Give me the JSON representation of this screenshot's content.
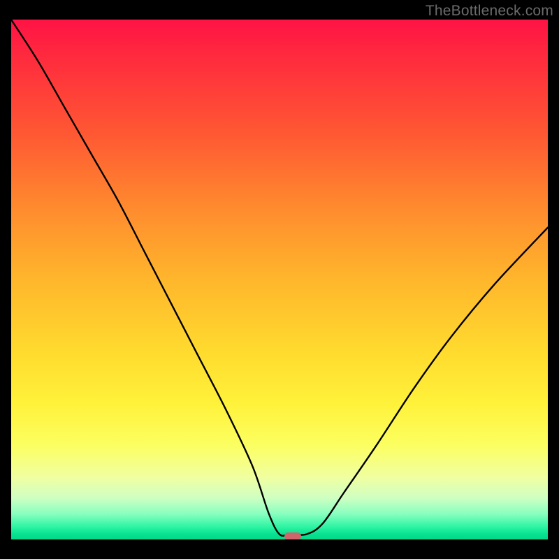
{
  "watermark": "TheBottleneck.com",
  "chart_data": {
    "type": "line",
    "title": "",
    "xlabel": "",
    "ylabel": "",
    "xlim": [
      0,
      100
    ],
    "ylim": [
      0,
      100
    ],
    "grid": false,
    "legend": false,
    "series": [
      {
        "name": "bottleneck-curve",
        "x": [
          0,
          5,
          10,
          15,
          20,
          25,
          30,
          35,
          40,
          45,
          48,
          50,
          52,
          55,
          58,
          62,
          68,
          75,
          82,
          90,
          100
        ],
        "y": [
          100,
          92,
          83,
          74,
          65,
          55,
          45,
          35,
          25,
          14,
          5,
          1,
          1,
          1,
          3,
          9,
          18,
          29,
          39,
          49,
          60
        ]
      }
    ],
    "annotations": [
      {
        "name": "optimal-marker",
        "x": 52.5,
        "y": 0.5
      }
    ],
    "background_gradient": {
      "top": "#ff1345",
      "mid": "#ffe233",
      "bottom": "#04d888"
    }
  }
}
